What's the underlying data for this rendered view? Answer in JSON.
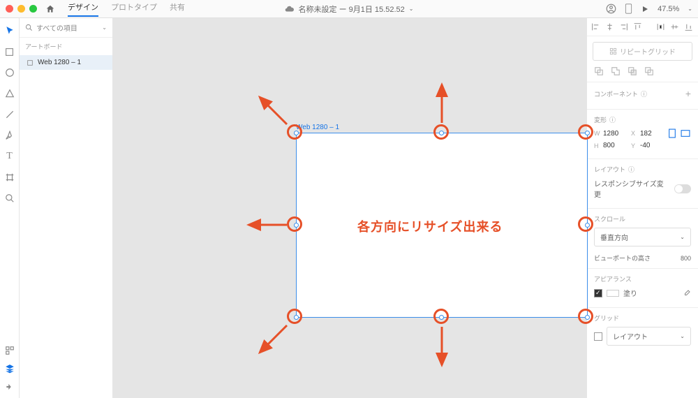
{
  "titlebar": {
    "tabs": [
      "デザイン",
      "プロトタイプ",
      "共有"
    ],
    "doc_title": "名称未設定 ー 9月1日 15.52.52",
    "zoom": "47.5%"
  },
  "leftpanel": {
    "search_label": "すべての項目",
    "section_artboards": "アートボード",
    "layer_name": "Web 1280 – 1"
  },
  "canvas": {
    "artboard_label": "Web 1280 – 1",
    "annotation": "各方向にリサイズ出来る"
  },
  "rightpanel": {
    "repeat_grid": "リピートグリッド",
    "components": "コンポーネント",
    "transform": "変形",
    "w": "1280",
    "h": "800",
    "x": "182",
    "y": "-40",
    "layout": "レイアウト",
    "responsive": "レスポンシブサイズ変更",
    "scroll": "スクロール",
    "scroll_value": "垂直方向",
    "viewport_label": "ビューポートの高さ",
    "viewport_value": "800",
    "appearance": "アピアランス",
    "fill": "塗り",
    "grid": "グリッド",
    "grid_value": "レイアウト"
  }
}
